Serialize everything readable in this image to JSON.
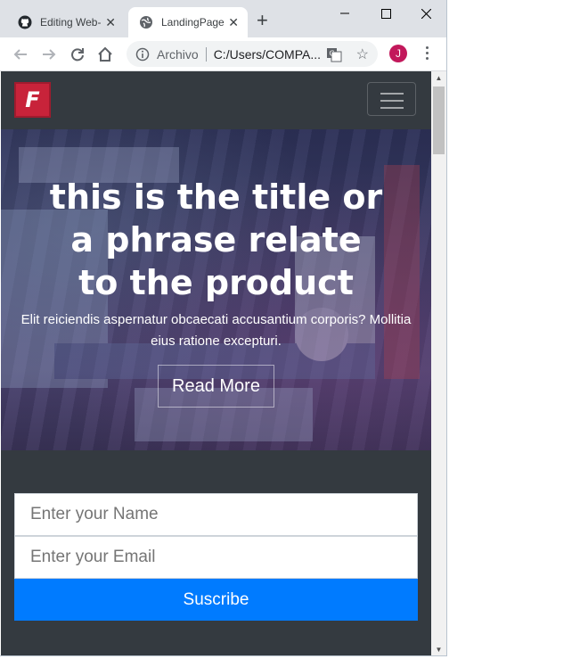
{
  "browser": {
    "tabs": [
      {
        "title": "Editing Web-",
        "icon": "github-icon",
        "active": false
      },
      {
        "title": "LandingPage",
        "icon": "globe-icon",
        "active": true
      }
    ],
    "address": {
      "scheme": "Archivo",
      "url": "C:/Users/COMPA..."
    },
    "avatar_initial": "J"
  },
  "navbar": {
    "brand_letter": "F",
    "brand_color": "#c8233a"
  },
  "hero": {
    "title": "this is the title or a phrase relate to the product",
    "subtitle": "Elit reiciendis aspernatur obcaecati accusantium corporis? Mollitia eius ratione excepturi.",
    "button_label": "Read More"
  },
  "form": {
    "name_placeholder": "Enter your Name",
    "email_placeholder": "Enter your Email",
    "submit_label": "Suscribe",
    "submit_color": "#007bff"
  }
}
